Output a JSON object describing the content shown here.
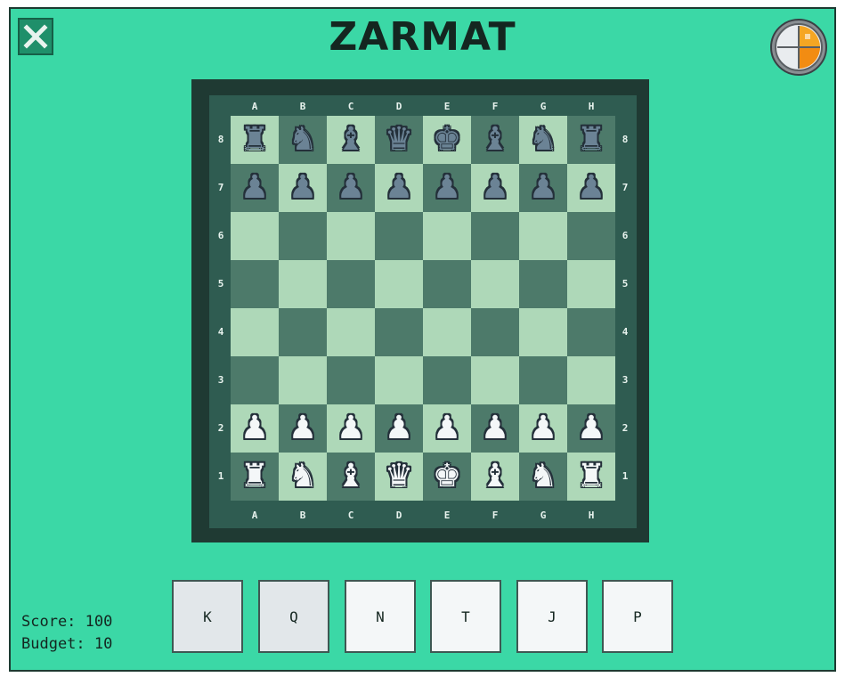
{
  "title": "ZARMAT",
  "board": {
    "files": [
      "A",
      "B",
      "C",
      "D",
      "E",
      "F",
      "G",
      "H"
    ],
    "ranks": [
      "8",
      "7",
      "6",
      "5",
      "4",
      "3",
      "2",
      "1"
    ],
    "rows": [
      [
        "r",
        "n",
        "b",
        "q",
        "k",
        "b",
        "n",
        "r"
      ],
      [
        "p",
        "p",
        "p",
        "p",
        "p",
        "p",
        "p",
        "p"
      ],
      [
        "",
        "",
        "",
        "",
        "",
        "",
        "",
        ""
      ],
      [
        "",
        "",
        "",
        "",
        "",
        "",
        "",
        ""
      ],
      [
        "",
        "",
        "",
        "",
        "",
        "",
        "",
        ""
      ],
      [
        "",
        "",
        "",
        "",
        "",
        "",
        "",
        ""
      ],
      [
        "P",
        "P",
        "P",
        "P",
        "P",
        "P",
        "P",
        "P"
      ],
      [
        "R",
        "N",
        "B",
        "Q",
        "K",
        "B",
        "N",
        "R"
      ]
    ],
    "light_color": "#aed8b8",
    "dark_color": "#4d7a6a",
    "white_piece_color": "#f4f7f8",
    "black_piece_color": "#6b8395"
  },
  "stats": {
    "score_label": "Score:",
    "score_value": "100",
    "budget_label": "Budget:",
    "budget_value": "10"
  },
  "shop": {
    "buttons": [
      {
        "label": "K",
        "pressed": true
      },
      {
        "label": "Q",
        "pressed": true
      },
      {
        "label": "N",
        "pressed": false
      },
      {
        "label": "T",
        "pressed": false
      },
      {
        "label": "J",
        "pressed": false
      },
      {
        "label": "P",
        "pressed": false
      }
    ]
  },
  "icons": {
    "close": "close-icon",
    "avatar": "pie-badge-icon"
  },
  "colors": {
    "background": "#3bd8a6",
    "accent": "#f5a623"
  }
}
